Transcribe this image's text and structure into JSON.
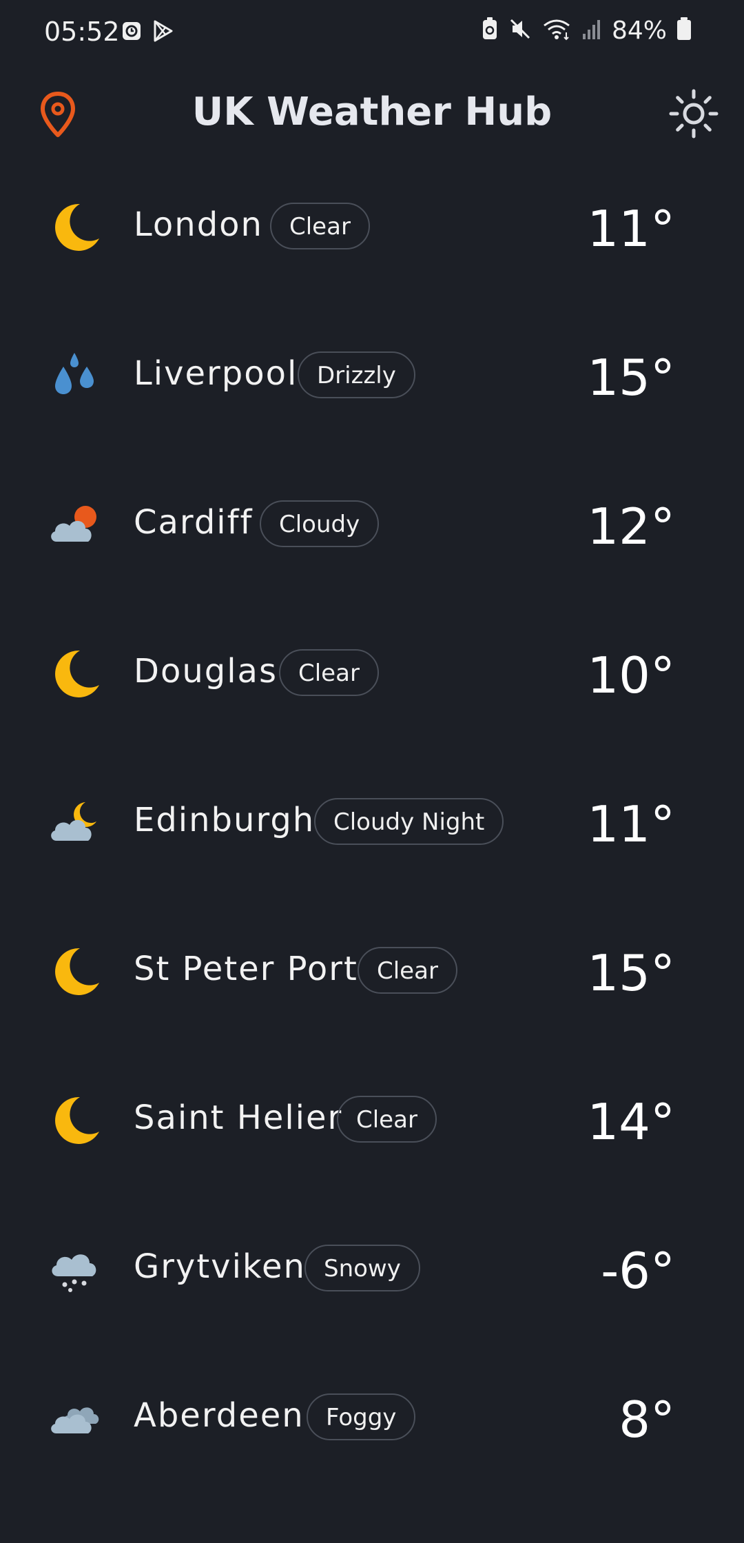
{
  "status_bar": {
    "time": "05:52",
    "battery": "84%"
  },
  "header": {
    "title": "UK Weather Hub"
  },
  "colors": {
    "background": "#1c1f26",
    "accent_location": "#e8591c",
    "moon": "#f9b80e",
    "cloud": "#a9bfd0",
    "rain": "#4a90d0"
  },
  "cities": [
    {
      "name": "London",
      "condition": "Clear",
      "temp": "11°",
      "icon": "moon-icon"
    },
    {
      "name": "Liverpool",
      "condition": "Drizzly",
      "temp": "15°",
      "icon": "raindrops-icon"
    },
    {
      "name": "Cardiff",
      "condition": "Cloudy",
      "temp": "12°",
      "icon": "cloud-sun-icon"
    },
    {
      "name": "Douglas",
      "condition": "Clear",
      "temp": "10°",
      "icon": "moon-icon"
    },
    {
      "name": "Edinburgh",
      "condition": "Cloudy Night",
      "temp": "11°",
      "icon": "cloud-moon-icon"
    },
    {
      "name": "St Peter Port",
      "condition": "Clear",
      "temp": "15°",
      "icon": "moon-icon"
    },
    {
      "name": "Saint Helier",
      "condition": "Clear",
      "temp": "14°",
      "icon": "moon-icon"
    },
    {
      "name": "Grytviken",
      "condition": "Snowy",
      "temp": "-6°",
      "icon": "snow-cloud-icon"
    },
    {
      "name": "Aberdeen",
      "condition": "Foggy",
      "temp": "8°",
      "icon": "fog-cloud-icon"
    }
  ]
}
